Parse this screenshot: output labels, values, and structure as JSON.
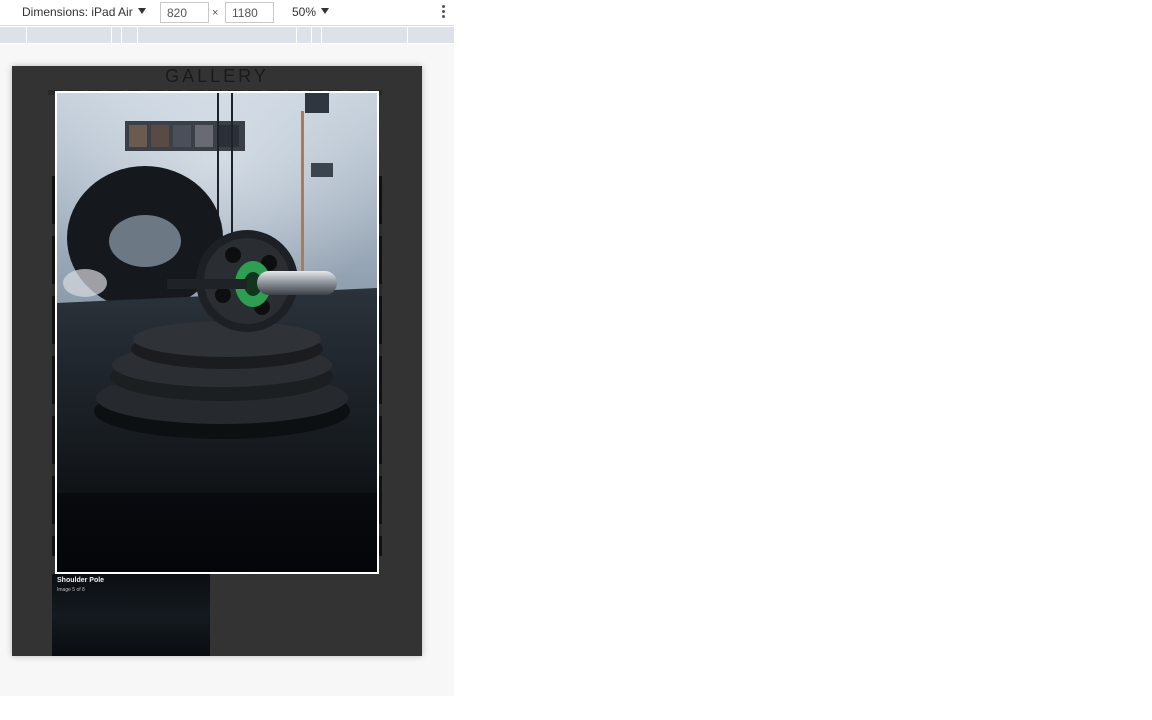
{
  "toolbar": {
    "device_label": "Dimensions: iPad Air",
    "width_value": "820",
    "times_symbol": "×",
    "height_value": "1180",
    "zoom_label": "50%",
    "more_icon": "kebab-menu-icon"
  },
  "page": {
    "title": "GALLERY",
    "lightbox": {
      "image_icon": "gym-barbell-photo",
      "caption_title": "Shoulder Pole",
      "caption_sub": "Image 5 of 8"
    }
  }
}
